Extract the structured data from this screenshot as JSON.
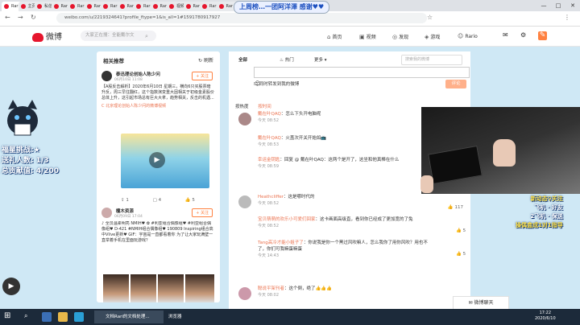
{
  "browser": {
    "tabs": [
      "Rari·",
      "主页",
      "私信",
      "Rari·",
      "Rari·",
      "Rari·",
      "Rari·",
      "Rari·",
      "Rari·",
      "Rari·",
      "视频",
      "Rari·",
      "Rari·",
      "Rari·",
      "Rari·"
    ],
    "url": "weibo.com/u/2219324641?profile_ftype=1&is_all=1#1591780917927",
    "win_min": "—",
    "win_max": "□",
    "win_close": "✕"
  },
  "overlay_banner": "上周榜…一团阿洋澤 感谢♥♥",
  "weibo": {
    "logo": "微博",
    "search_placeholder": "大家正在搜：全能戴尔文",
    "nav": [
      "首页",
      "视频",
      "发现",
      "游戏",
      "Rario"
    ]
  },
  "streamer_left": {
    "line1": "福星挑战:★",
    "line2": "送礼人数: 1/3",
    "line3": "总贡献值: 4/200"
  },
  "rec_panel": {
    "title": "相关推荐",
    "refresh": "刷新",
    "post1": {
      "name": "泰迅理论创始人陈少问",
      "time": "06月10日 11:08",
      "follow": "+ 关注",
      "text": "【A股反击解析】2020年6月10日 星期三，横向6只买股票暗升反，周三早往翻红，这个指数演变重大因相关于初级金素股价总体上升，这引起市场总有巨大大拿，趋势相关，反击的机遇...",
      "link": "C 北京理论创始人陈少问的微博视频",
      "reposts": "1",
      "comments": "4",
      "likes": "5"
    },
    "post2": {
      "name": "檀木资源",
      "time": "06月09日 17:04",
      "follow": "+ 关注",
      "text": "♪ 全员温柔明亮 NMIH♥ ✿ #利亚组合偶像组♥ #利亚组合偶像组♥ D-421 #NMIH组合偶像组♥ 190809 Inspiring组合高中Vlive更新♥ GIF：宇宙是一直都看着你 为了让大家玩满壁一直举着手机在里面玩游戏？"
    }
  },
  "main": {
    "tabs": [
      "全部",
      "热门",
      "更多"
    ],
    "search_placeholder": "搜索我的微博",
    "forward_label": "同时转发到我的微博",
    "post_button": "评论",
    "sort_hot": "按热度",
    "sort_time": "按时间",
    "comments": [
      {
        "user": "戴在叶QAQ",
        "text": "：怎么下头开电脑呢",
        "time": "今天 08:52"
      },
      {
        "user": "戴在叶QAQ",
        "text": "：火盖次开关开始如📺",
        "time": "今天 08:53",
        "sub": true
      },
      {
        "user": "幸运金钥匙",
        "text": "：回复 @ 戴在叶QAQ：这两个是开了，这坐和他真棒在什么",
        "time": "今天 08:59",
        "sub": true,
        "like": "1"
      },
      {
        "user": "Heathcliffer",
        "text": "：这是哪时代的",
        "time": "今天 08:52",
        "like": "117"
      },
      {
        "user": "宝贝萌萌的欢乐小可爱们回家",
        "text": "：这卡画面高级直，看到你已经成了更加宽的了兔",
        "time": "今天 08:52",
        "sub": true,
        "like": "5"
      },
      {
        "user": "Tang高冷才能小姐子了",
        "text": "：你说我是你一个黑过风吹嘛人，怎么我你了用你风吹？用也不了，你们可我嘛蛋嘛蛋",
        "time": "今天 14:43",
        "sub": true,
        "like": "5"
      },
      {
        "user": "聪说平架刊者",
        "text": "：这个倒，绝了👍👍👍",
        "time": "今天 08:02"
      }
    ]
  },
  "streamer_right": {
    "line1": "新动态♀关注",
    "line2": "飞机 · 好友",
    "line3": "2飞机 · 保送",
    "line4": "操偶盒成1对1指导",
    "chat_popup": "微博聊天"
  },
  "taskbar": {
    "apps": [
      "文档Rari的文档处理...",
      "浏览器"
    ],
    "time": "17:22",
    "date": "2020/6/10"
  },
  "colors": {
    "brand": "#e6162d",
    "accent": "#ff8140",
    "link": "#eb7350"
  }
}
